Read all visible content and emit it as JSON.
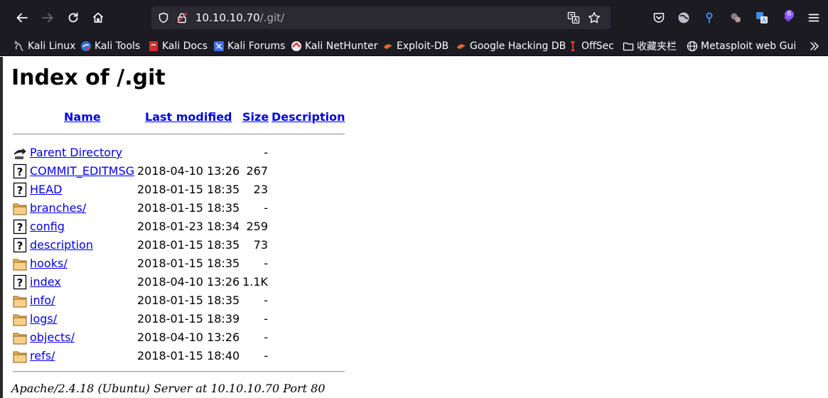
{
  "browser": {
    "url_host": "10.10.10.70",
    "url_path": "/.git/",
    "extension_badge": "6",
    "bookmarks": [
      {
        "label": "Kali Linux",
        "icon": "kali-dragon-icon"
      },
      {
        "label": "Kali Tools",
        "icon": "kali-tools-icon"
      },
      {
        "label": "Kali Docs",
        "icon": "kali-docs-icon"
      },
      {
        "label": "Kali Forums",
        "icon": "kali-forums-icon"
      },
      {
        "label": "Kali NetHunter",
        "icon": "nethunter-icon"
      },
      {
        "label": "Exploit-DB",
        "icon": "exploit-db-icon"
      },
      {
        "label": "Google Hacking DB",
        "icon": "ghdb-icon"
      },
      {
        "label": "OffSec",
        "icon": "offsec-icon"
      },
      {
        "label": "收藏夹栏",
        "icon": "folder-icon"
      },
      {
        "label": "Metasploit web Gui",
        "icon": "globe-icon"
      }
    ]
  },
  "listing": {
    "title": "Index of /.git",
    "columns": {
      "name": "Name",
      "modified": "Last modified",
      "size": "Size",
      "description": "Description"
    },
    "entries": [
      {
        "name": "Parent Directory",
        "modified": "",
        "size": "-",
        "icon": "back-arrow-icon"
      },
      {
        "name": "COMMIT_EDITMSG",
        "modified": "2018-04-10 13:26",
        "size": "267",
        "icon": "unknown-file-icon"
      },
      {
        "name": "HEAD",
        "modified": "2018-01-15 18:35",
        "size": "23",
        "icon": "unknown-file-icon"
      },
      {
        "name": "branches/",
        "modified": "2018-01-15 18:35",
        "size": "-",
        "icon": "folder-icon"
      },
      {
        "name": "config",
        "modified": "2018-01-23 18:34",
        "size": "259",
        "icon": "unknown-file-icon"
      },
      {
        "name": "description",
        "modified": "2018-01-15 18:35",
        "size": "73",
        "icon": "unknown-file-icon"
      },
      {
        "name": "hooks/",
        "modified": "2018-01-15 18:35",
        "size": "-",
        "icon": "folder-icon"
      },
      {
        "name": "index",
        "modified": "2018-04-10 13:26",
        "size": "1.1K",
        "icon": "unknown-file-icon"
      },
      {
        "name": "info/",
        "modified": "2018-01-15 18:35",
        "size": "-",
        "icon": "folder-icon"
      },
      {
        "name": "logs/",
        "modified": "2018-01-15 18:39",
        "size": "-",
        "icon": "folder-icon"
      },
      {
        "name": "objects/",
        "modified": "2018-04-10 13:26",
        "size": "-",
        "icon": "folder-icon"
      },
      {
        "name": "refs/",
        "modified": "2018-01-15 18:40",
        "size": "-",
        "icon": "folder-icon"
      }
    ],
    "footer": "Apache/2.4.18 (Ubuntu) Server at 10.10.10.70 Port 80"
  },
  "colors": {
    "chrome": "#1c1b22",
    "urlbar": "#2b2a33",
    "link": "#0000ee"
  }
}
